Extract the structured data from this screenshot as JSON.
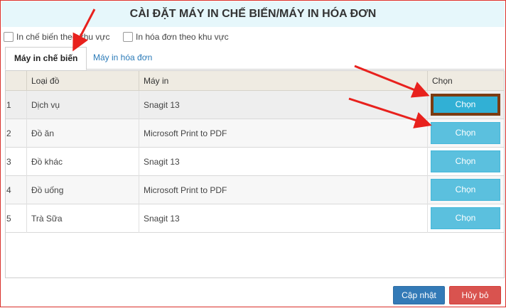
{
  "dialog": {
    "title": "CÀI ĐẶT MÁY IN CHẾ BIẾN/MÁY IN HÓA ĐƠN",
    "options": [
      {
        "label": "In chế biến theo khu vực",
        "checked": false
      },
      {
        "label": "In hóa đơn theo khu vực",
        "checked": false
      }
    ],
    "tabs": [
      {
        "label": "Máy in chế biến",
        "active": true
      },
      {
        "label": "Máy in hóa đơn",
        "active": false
      }
    ],
    "table": {
      "columns": [
        "",
        "Loại đồ",
        "Máy in",
        "Chọn"
      ],
      "rows": [
        {
          "index": "1",
          "category": "Dịch vụ",
          "printer": "Snagit 13",
          "action": "Chọn"
        },
        {
          "index": "2",
          "category": "Đồ ăn",
          "printer": "Microsoft Print to PDF",
          "action": "Chọn"
        },
        {
          "index": "3",
          "category": "Đồ khác",
          "printer": "Snagit 13",
          "action": "Chọn"
        },
        {
          "index": "4",
          "category": "Đồ uống",
          "printer": "Microsoft Print to PDF",
          "action": "Chọn"
        },
        {
          "index": "5",
          "category": "Trà Sữa",
          "printer": "Snagit 13",
          "action": "Chọn"
        }
      ]
    },
    "buttons": {
      "update": "Cập nhật",
      "cancel": "Hủy bỏ"
    }
  },
  "colors": {
    "accent": "#5bc0de",
    "primary": "#337ab7",
    "danger": "#d9534f",
    "annotation": "#e8211d",
    "highlight_border": "#7a3b12"
  }
}
